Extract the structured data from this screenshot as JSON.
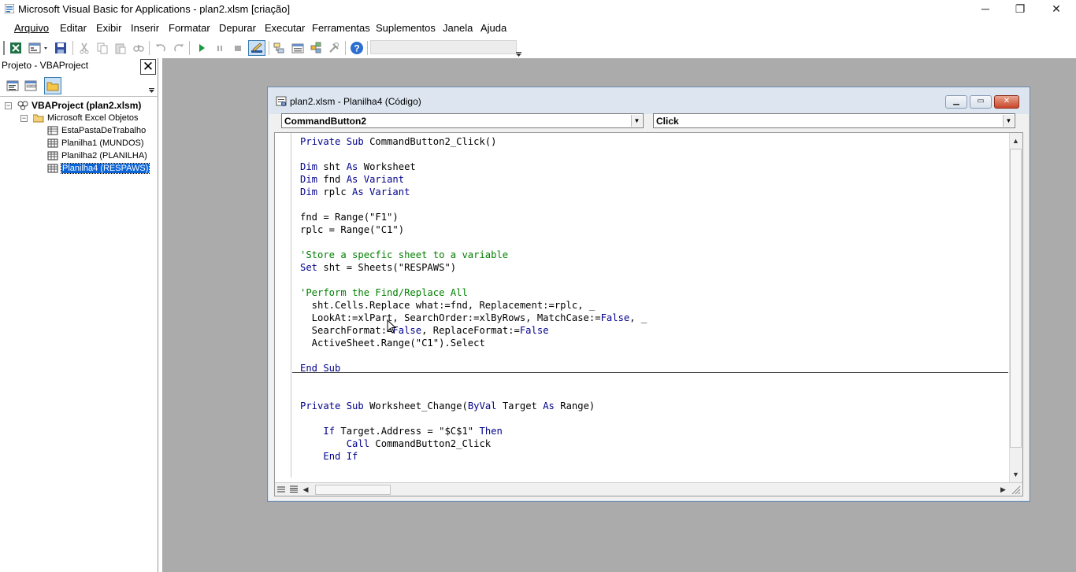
{
  "app": {
    "title": "Microsoft Visual Basic for Applications - plan2.xlsm [criação]",
    "window_buttons": [
      "─",
      "❐",
      "✕"
    ]
  },
  "menu": [
    "Arquivo",
    "Editar",
    "Exibir",
    "Inserir",
    "Formatar",
    "Depurar",
    "Executar",
    "Ferramentas",
    "Suplementos",
    "Janela",
    "Ajuda"
  ],
  "project": {
    "title": "Projeto - VBAProject",
    "close": "✕",
    "root": "VBAProject (plan2.xlsm)",
    "folder": "Microsoft Excel Objetos",
    "items": [
      "EstaPastaDeTrabalho",
      "Planilha1 (MUNDOS)",
      "Planilha2 (PLANILHA)",
      "Planilha4 (RESPAWS)"
    ],
    "selected_index": 3
  },
  "code_window": {
    "title": "plan2.xlsm - Planilha4 (Código)",
    "object_combo": "CommandButton2",
    "procedure_combo": "Click",
    "lines": [
      [
        [
          "kw",
          "Private Sub "
        ],
        [
          "t",
          "CommandButton2_Click()"
        ]
      ],
      [],
      [
        [
          "kw",
          "Dim "
        ],
        [
          "t",
          "sht "
        ],
        [
          "kw",
          "As "
        ],
        [
          "t",
          "Worksheet"
        ]
      ],
      [
        [
          "kw",
          "Dim "
        ],
        [
          "t",
          "fnd "
        ],
        [
          "kw",
          "As Variant"
        ]
      ],
      [
        [
          "kw",
          "Dim "
        ],
        [
          "t",
          "rplc "
        ],
        [
          "kw",
          "As Variant"
        ]
      ],
      [],
      [
        [
          "t",
          "fnd = Range(\"F1\")"
        ]
      ],
      [
        [
          "t",
          "rplc = Range(\"C1\")"
        ]
      ],
      [],
      [
        [
          "cm",
          "'Store a specfic sheet to a variable"
        ]
      ],
      [
        [
          "kw",
          "Set "
        ],
        [
          "t",
          "sht = Sheets(\"RESPAWS\")"
        ]
      ],
      [],
      [
        [
          "cm",
          "'Perform the Find/Replace All"
        ]
      ],
      [
        [
          "t",
          "  sht.Cells.Replace what:=fnd, Replacement:=rplc, _"
        ]
      ],
      [
        [
          "t",
          "  LookAt:=xlPart, SearchOrder:=xlByRows, MatchCase:="
        ],
        [
          "kw",
          "False"
        ],
        [
          "t",
          ", _"
        ]
      ],
      [
        [
          "t",
          "  SearchFormat:="
        ],
        [
          "kw",
          "False"
        ],
        [
          "t",
          ", ReplaceFormat:="
        ],
        [
          "kw",
          "False"
        ]
      ],
      [
        [
          "t",
          "  ActiveSheet.Range(\"C1\").Select"
        ]
      ],
      [],
      [
        [
          "kw",
          "End Sub"
        ]
      ],
      [],
      [],
      [
        [
          "kw",
          "Private Sub "
        ],
        [
          "t",
          "Worksheet_Change("
        ],
        [
          "kw",
          "ByVal "
        ],
        [
          "t",
          "Target "
        ],
        [
          "kw",
          "As "
        ],
        [
          "t",
          "Range)"
        ]
      ],
      [],
      [
        [
          "t",
          "    "
        ],
        [
          "kw",
          "If "
        ],
        [
          "t",
          "Target.Address = \"$C$1\" "
        ],
        [
          "kw",
          "Then"
        ]
      ],
      [
        [
          "t",
          "        "
        ],
        [
          "kw",
          "Call "
        ],
        [
          "t",
          "CommandButton2_Click"
        ]
      ],
      [
        [
          "t",
          "    "
        ],
        [
          "kw",
          "End If"
        ]
      ]
    ]
  }
}
